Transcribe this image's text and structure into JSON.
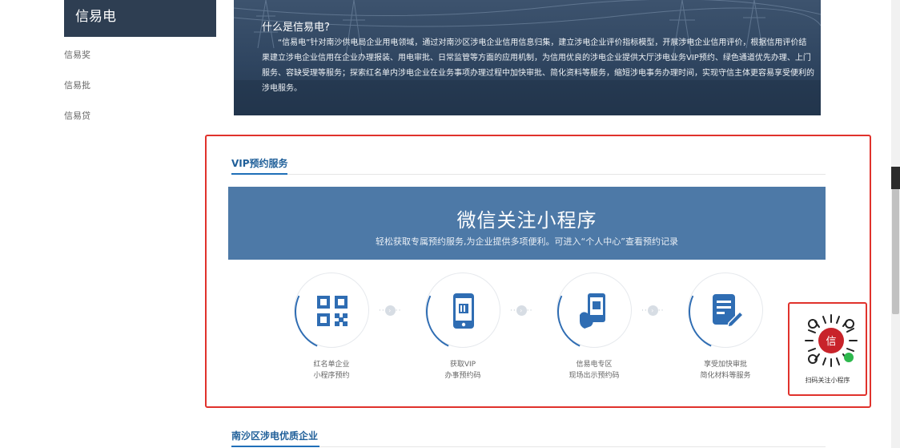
{
  "sidebar": {
    "title": "信易电",
    "items": [
      {
        "label": "信易奖"
      },
      {
        "label": "信易批"
      },
      {
        "label": "信易贷"
      }
    ]
  },
  "banner": {
    "title": "什么是信易电?",
    "text": "“信易电”针对南沙供电局企业用电领域，通过对南沙区涉电企业信用信息归集，建立涉电企业评价指标模型，开展涉电企业信用评价，根据信用评价结果建立涉电企业信用在企业办理报装、用电审批、日常监管等方面的应用机制，为信用优良的涉电企业提供大厅涉电业务VIP预约、绿色通道优先办理、上门服务、容缺受理等服务；探索红名单内涉电企业在业务事项办理过程中加快审批、简化资料等服务，缩短涉电事务办理时间，实现守信主体更容易享受便利的涉电服务。"
  },
  "vip_section": {
    "tab_label": "VIP预约服务",
    "headline": "微信关注小程序",
    "subline": "轻松获取专属预约服务,为企业提供多项便利。可进入“个人中心”查看预约记录",
    "steps": [
      {
        "icon": "qr-code-icon",
        "line1": "红名单企业",
        "line2": "小程序预约"
      },
      {
        "icon": "phone-icon",
        "line1": "获取VIP",
        "line2": "办事预约码"
      },
      {
        "icon": "hand-phone-icon",
        "line1": "信易电专区",
        "line2": "现场出示预约码"
      },
      {
        "icon": "document-pen-icon",
        "line1": "享受加快审批",
        "line2": "简化材料等服务"
      }
    ],
    "qr_label": "扫码关注小程序",
    "qr_badge_char": "信"
  },
  "bottom_section": {
    "title": "南沙区涉电优质企业"
  },
  "colors": {
    "sidebar_header": "#2e3e52",
    "accent_blue": "#1f6fb8",
    "banner_blue": "#4d79a7",
    "highlight_red": "#e0322c"
  }
}
